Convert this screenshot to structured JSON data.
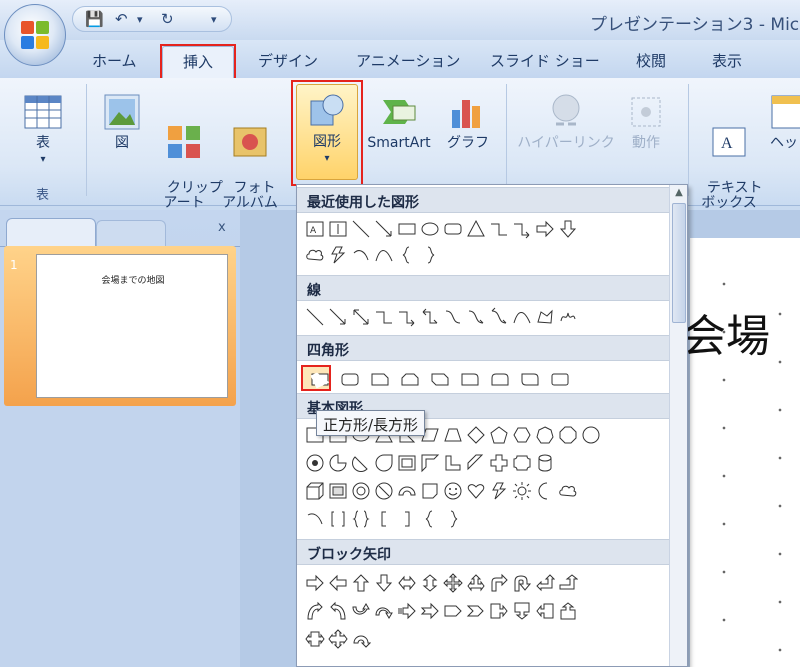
{
  "window": {
    "title": "プレゼンテーション3 - Micr"
  },
  "quick_access": {
    "save_icon": "save-icon",
    "undo_icon": "undo-icon",
    "redo_icon": "redo-icon",
    "customize_icon": "customize-qat-icon"
  },
  "tabs": [
    {
      "label": "ホーム"
    },
    {
      "label": "挿入",
      "active": true
    },
    {
      "label": "デザイン"
    },
    {
      "label": "アニメーション"
    },
    {
      "label": "スライド ショー"
    },
    {
      "label": "校閲"
    },
    {
      "label": "表示"
    }
  ],
  "ribbon": {
    "table": {
      "label": "表",
      "group_label": "表"
    },
    "picture": {
      "label": "図"
    },
    "clipart": {
      "label": "クリップ\nアート"
    },
    "photoalbum": {
      "label": "フォト\nアルバム"
    },
    "shapes": {
      "label": "図形"
    },
    "smartart": {
      "label": "SmartArt"
    },
    "graph": {
      "label": "グラフ"
    },
    "hyperlink": {
      "label": "ハイパーリンク"
    },
    "action": {
      "label": "動作"
    },
    "textbox": {
      "label": "テキスト\nボックス"
    },
    "header": {
      "label": "ヘッ"
    }
  },
  "slides_panel": {
    "close": "x",
    "slide_number": "1",
    "slide_title": "会場までの地図"
  },
  "slide": {
    "title_text": "会場"
  },
  "shapes_gallery": {
    "categories": [
      {
        "label": "最近使用した図形"
      },
      {
        "label": "線"
      },
      {
        "label": "四角形"
      },
      {
        "label": "基本図形"
      },
      {
        "label": "ブロック矢印"
      }
    ],
    "tooltip": "正方形/長方形",
    "accent_color": "#e5231d"
  }
}
